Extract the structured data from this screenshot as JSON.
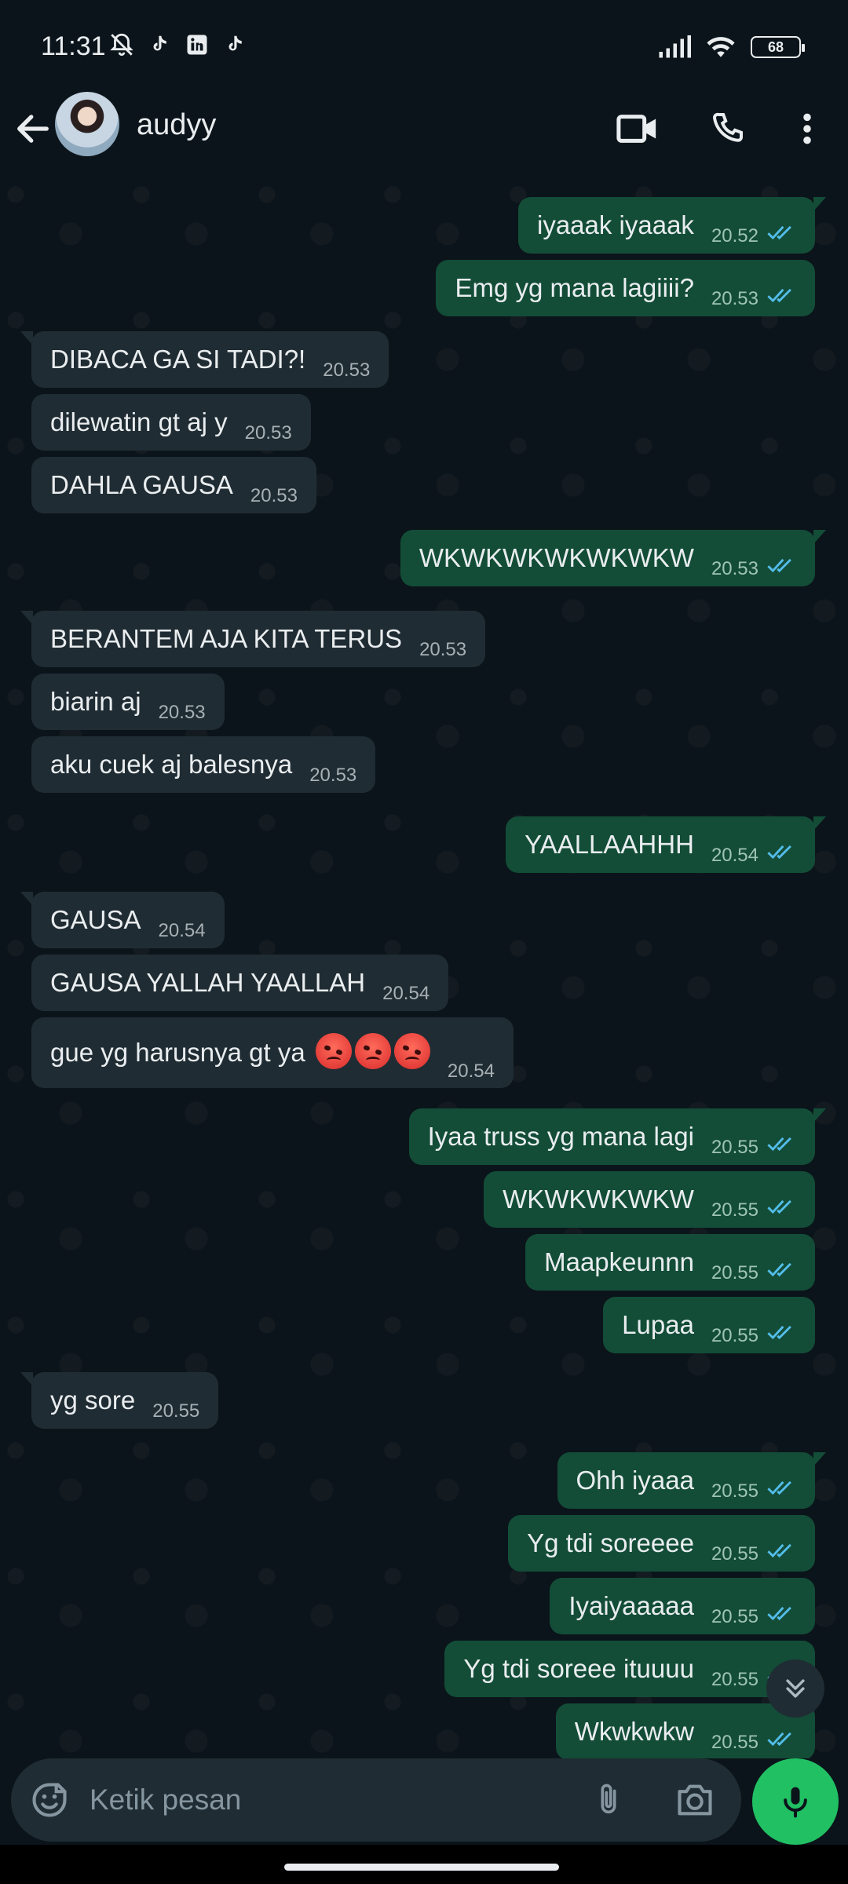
{
  "status_bar": {
    "time": "11:31",
    "battery": "68"
  },
  "header": {
    "contact_name": "audyy"
  },
  "messages": [
    {
      "dir": "out",
      "text": "iyaaak iyaaak",
      "time": "20.52"
    },
    {
      "dir": "out",
      "text": "Emg yg mana lagiiii?",
      "time": "20.53"
    },
    {
      "dir": "in",
      "text": "DIBACA GA SI TADI?!",
      "time": "20.53"
    },
    {
      "dir": "in",
      "text": "dilewatin gt aj y",
      "time": "20.53"
    },
    {
      "dir": "in",
      "text": "DAHLA GAUSA",
      "time": "20.53"
    },
    {
      "dir": "out",
      "text": "WKWKWKWKWKWKW",
      "time": "20.53"
    },
    {
      "dir": "in",
      "text": "BERANTEM AJA KITA TERUS",
      "time": "20.53"
    },
    {
      "dir": "in",
      "text": "biarin aj",
      "time": "20.53"
    },
    {
      "dir": "in",
      "text": "aku cuek aj balesnya",
      "time": "20.53"
    },
    {
      "dir": "out",
      "text": "YAALLAAHHH",
      "time": "20.54"
    },
    {
      "dir": "in",
      "text": "GAUSA",
      "time": "20.54"
    },
    {
      "dir": "in",
      "text": "GAUSA YALLAH YAALLAH",
      "time": "20.54"
    },
    {
      "dir": "in",
      "text": "gue yg harusnya gt ya",
      "time": "20.54"
    },
    {
      "dir": "out",
      "text": "Iyaa truss yg mana lagi",
      "time": "20.55"
    },
    {
      "dir": "out",
      "text": "WKWKWKWKW",
      "time": "20.55"
    },
    {
      "dir": "out",
      "text": "Maapkeunnn",
      "time": "20.55"
    },
    {
      "dir": "out",
      "text": "Lupaa",
      "time": "20.55"
    },
    {
      "dir": "in",
      "text": "yg sore",
      "time": "20.55"
    },
    {
      "dir": "out",
      "text": "Ohh iyaaa",
      "time": "20.55"
    },
    {
      "dir": "out",
      "text": "Yg tdi soreeee",
      "time": "20.55"
    },
    {
      "dir": "out",
      "text": "Iyaiyaaaaa",
      "time": "20.55"
    },
    {
      "dir": "out",
      "text": "Yg tdi soreee ituuuu",
      "time": "20.55"
    },
    {
      "dir": "out",
      "text": "Wkwkwkw",
      "time": "20.55"
    }
  ],
  "composer": {
    "placeholder": "Ketik pesan"
  },
  "icons": {
    "status": [
      "dnd-icon",
      "tiktok-icon",
      "linkedin-icon",
      "tiktok-icon",
      "signal-icon",
      "wifi-icon",
      "battery-icon"
    ],
    "header": [
      "back-arrow-icon",
      "video-call-icon",
      "voice-call-icon",
      "more-options-icon"
    ],
    "composer": [
      "emoji-sticker-icon",
      "attach-icon",
      "camera-icon",
      "mic-icon"
    ]
  },
  "colors": {
    "incoming": "#202c33",
    "outgoing": "#134d37",
    "read_ticks": "#53bdeb",
    "mic": "#21c063"
  }
}
